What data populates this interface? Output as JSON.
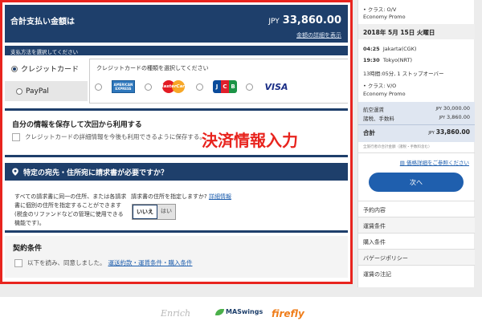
{
  "payment": {
    "total_label": "合計支払い金額は",
    "total_currency": "JPY",
    "total_amount": "33,860.00",
    "details_link": "金額の詳細を表示",
    "method_heading": "支払方法を選択してください",
    "methods": [
      {
        "label": "クレジットカード",
        "selected": true
      },
      {
        "label": "PayPal",
        "selected": false
      }
    ],
    "card_select_label": "クレジットカードの種類を選択してください",
    "card_logos": {
      "amex": "AMERICAN EXPRESS",
      "mastercard": "MasterCard",
      "jcb": [
        "J",
        "C",
        "B"
      ],
      "visa": "VISA"
    }
  },
  "save_info": {
    "title": "自分の情報を保存して次回から利用する",
    "checkbox_label": "クレジットカードの詳細情報を今後も利用できるように保存する。"
  },
  "annotation": "決済情報入力",
  "invoice": {
    "title": "特定の宛先・住所宛に請求書が必要ですか？",
    "description": "すべての請求書に同一の住所、または各請求書に個別の住所を指定することができます(税金のリファンドなどの管理に使用できる機能です)。",
    "question": "請求書の住所を指定しますか?",
    "question_link": "詳細情報",
    "toggle_no": "いいえ",
    "toggle_yes": "はい"
  },
  "terms": {
    "title": "契約条件",
    "checkbox_prefix": "以下を読み、同意しました。",
    "link": "運送約款・運賃条件・購入条件"
  },
  "itinerary": {
    "class1": "• クラス: O/V",
    "fare1": "Economy Promo",
    "date": "2018年 5月 15日 火曜日",
    "dep_time": "04:25",
    "dep_place": "Jakarta(CGK)",
    "arr_time": "19:30",
    "arr_place": "Tokyo(NRT)",
    "duration": "13時間:05分, 1 ストップオーバー",
    "class2": "• クラス: V/O",
    "fare2": "Economy Promo"
  },
  "fare": {
    "base_label": "航空運賃",
    "base_currency": "JPY",
    "base_amount": "30,000.00",
    "tax_label": "諸税、手数料",
    "tax_currency": "JPY",
    "tax_amount": "3,860.00",
    "total_label": "合計",
    "total_currency": "JPY",
    "total_amount": "33,860.00",
    "included_note": "全旅行者の合計金額（諸税・手数料含む）",
    "rules_link": "価格詳細をご参照ください",
    "next_button": "次へ"
  },
  "sidebar_nav": [
    "予約内容",
    "運賃条件",
    "購入条件",
    "バゲージポリシー",
    "運賃の注記"
  ],
  "footer": {
    "enrich": "Enrich",
    "mas": "MASwings",
    "firefly": "firefly"
  },
  "colors": {
    "navy": "#1e3f6b",
    "link_blue": "#1f5fae",
    "highlight_red": "#e8241e"
  }
}
